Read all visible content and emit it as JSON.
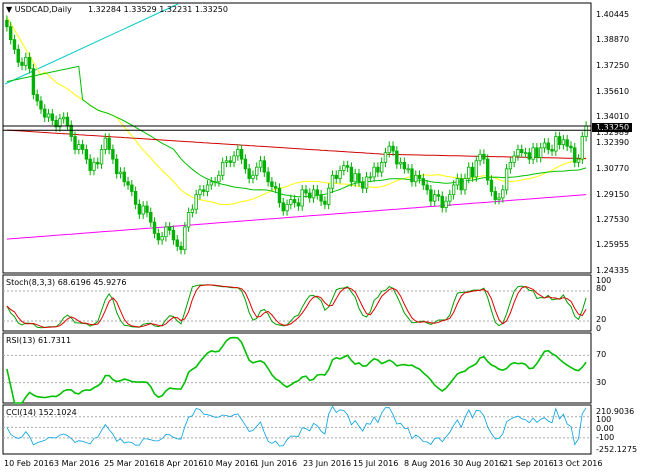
{
  "colors": {
    "background": "#ffffff",
    "candle_up": "#00b000",
    "candle_down": "#00b000",
    "ma_fast": "#00c000",
    "ma_slow": "#d00000",
    "ma_yellow": "#ffff00",
    "ma_magenta": "#ff00ff",
    "trend": "#00c8c8",
    "stoch_main": "#00a000",
    "stoch_signal": "#e00000",
    "rsi": "#00c000",
    "cci": "#00a0e0",
    "level": "#000000"
  },
  "main": {
    "symbol_label": "▼ USDCAD,Daily",
    "ohlc_text": "1.32284 1.33529 1.32231 1.33250",
    "price_axis": [
      "1.40445",
      "1.38870",
      "1.37250",
      "1.35610",
      "1.34010",
      "1.33250",
      "1.32989",
      "1.32390",
      "1.30770",
      "1.29150",
      "1.27530",
      "1.25955",
      "1.24335"
    ],
    "current_price": "1.33250",
    "level_price": "1.32989"
  },
  "stoch": {
    "label": "Stoch(8,3,3) 68.6196 45.9276",
    "axis": [
      "100",
      "80",
      "20",
      "0"
    ]
  },
  "rsi": {
    "label": "RSI(13) 61.7311",
    "axis": [
      "70",
      "30"
    ]
  },
  "cci": {
    "label": "CCI(14) 152.1024",
    "axis": [
      "210.9036",
      "100",
      "0.00",
      "-100",
      "-252.1275"
    ]
  },
  "time_axis": [
    "10 Feb 2016",
    "3 Mar 2016",
    "25 Mar 2016",
    "18 Apr 2016",
    "10 May 2016",
    "1 Jun 2016",
    "23 Jun 2016",
    "15 Jul 2016",
    "8 Aug 2016",
    "30 Aug 2016",
    "21 Sep 2016",
    "13 Oct 2016"
  ],
  "chart_data": {
    "type": "candlestick",
    "symbol": "USDCAD",
    "timeframe": "Daily",
    "last_ohlc": {
      "open": 1.32284,
      "high": 1.33529,
      "low": 1.32231,
      "close": 1.3325
    },
    "closes": [
      1.394,
      1.386,
      1.38,
      1.372,
      1.37,
      1.375,
      1.368,
      1.352,
      1.348,
      1.343,
      1.338,
      1.34,
      1.336,
      1.332,
      1.337,
      1.338,
      1.333,
      1.326,
      1.318,
      1.321,
      1.318,
      1.312,
      1.305,
      1.31,
      1.309,
      1.318,
      1.325,
      1.318,
      1.312,
      1.303,
      1.304,
      1.298,
      1.296,
      1.292,
      1.284,
      1.278,
      1.283,
      1.279,
      1.273,
      1.266,
      1.262,
      1.264,
      1.27,
      1.268,
      1.262,
      1.258,
      1.256,
      1.27,
      1.279,
      1.281,
      1.29,
      1.293,
      1.292,
      1.296,
      1.298,
      1.298,
      1.302,
      1.31,
      1.311,
      1.31,
      1.314,
      1.318,
      1.312,
      1.306,
      1.3,
      1.302,
      1.307,
      1.311,
      1.304,
      1.298,
      1.295,
      1.294,
      1.285,
      1.28,
      1.284,
      1.287,
      1.285,
      1.283,
      1.293,
      1.291,
      1.288,
      1.293,
      1.29,
      1.286,
      1.284,
      1.294,
      1.302,
      1.3,
      1.305,
      1.308,
      1.307,
      1.298,
      1.303,
      1.298,
      1.294,
      1.301,
      1.301,
      1.307,
      1.304,
      1.31,
      1.316,
      1.32,
      1.317,
      1.309,
      1.31,
      1.306,
      1.306,
      1.298,
      1.302,
      1.3,
      1.296,
      1.293,
      1.286,
      1.29,
      1.289,
      1.282,
      1.286,
      1.29,
      1.296,
      1.3,
      1.293,
      1.3,
      1.307,
      1.301,
      1.311,
      1.315,
      1.312,
      1.299,
      1.292,
      1.287,
      1.288,
      1.293,
      1.306,
      1.31,
      1.314,
      1.318,
      1.316,
      1.316,
      1.312,
      1.319,
      1.313,
      1.319,
      1.322,
      1.318,
      1.317,
      1.326,
      1.321,
      1.324,
      1.32,
      1.319,
      1.31,
      1.312,
      1.326,
      1.3325
    ],
    "price_axis_ticks": [
      1.40445,
      1.3887,
      1.3725,
      1.3561,
      1.3401,
      1.3239,
      1.3077,
      1.2915,
      1.2753,
      1.25955,
      1.24335
    ],
    "horizontal_level": 1.32989,
    "indicators": {
      "stochastic": {
        "params": "8,3,3",
        "main": 68.6196,
        "signal": 45.9276,
        "levels": [
          20,
          80
        ]
      },
      "rsi": {
        "period": 13,
        "value": 61.7311,
        "levels": [
          30,
          70
        ]
      },
      "cci": {
        "period": 14,
        "value": 152.1024,
        "levels": [
          -100,
          0,
          100
        ],
        "range": [
          -252.1275,
          210.9036
        ]
      }
    },
    "x_labels": [
      "10 Feb 2016",
      "3 Mar 2016",
      "25 Mar 2016",
      "18 Apr 2016",
      "10 May 2016",
      "1 Jun 2016",
      "23 Jun 2016",
      "15 Jul 2016",
      "8 Aug 2016",
      "30 Aug 2016",
      "21 Sep 2016",
      "13 Oct 2016"
    ]
  }
}
